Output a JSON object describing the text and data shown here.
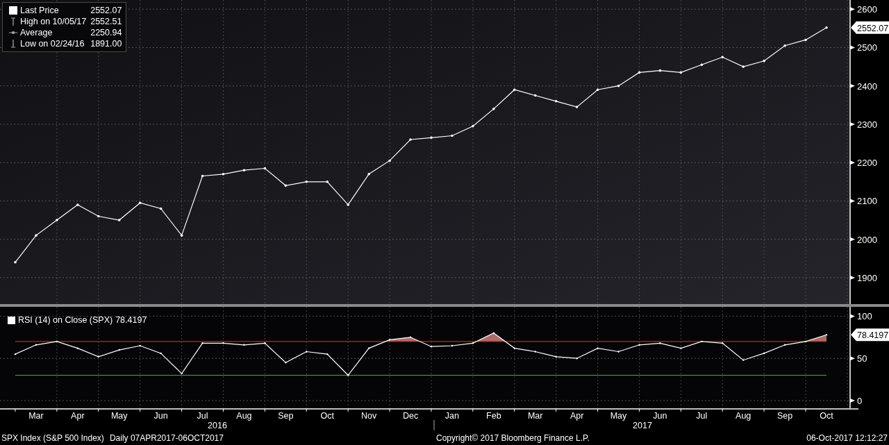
{
  "price_panel": {
    "legend": [
      {
        "kind": "last",
        "value": "2552.07"
      },
      {
        "kind": "high",
        "label": "High on 10/05/17",
        "value": "2552.51"
      },
      {
        "kind": "average",
        "label": "Average",
        "value": "2250.94"
      },
      {
        "kind": "low",
        "label": "Low on 02/24/16",
        "value": "1891.00"
      }
    ],
    "last_value_tag": "2552.07",
    "chart_data": {
      "type": "line",
      "grid": true,
      "series": [
        {
          "name": "Last Price",
          "color": "#ffffff",
          "values": [
            1940,
            2010,
            2050,
            2090,
            2060,
            2050,
            2095,
            2080,
            2010,
            2165,
            2170,
            2180,
            2185,
            2140,
            2150,
            2150,
            2090,
            2170,
            2205,
            2260,
            2265,
            2270,
            2295,
            2340,
            2390,
            2375,
            2360,
            2345,
            2390,
            2400,
            2435,
            2440,
            2435,
            2455,
            2475,
            2450,
            2465,
            2505,
            2520,
            2552
          ]
        }
      ],
      "ylim": [
        1831,
        2624
      ],
      "yticks": [
        1900,
        2000,
        2100,
        2200,
        2300,
        2400,
        2500,
        2600
      ]
    }
  },
  "rsi_panel": {
    "legend": {
      "value": "78.4197"
    },
    "last_value_tag": "78.4197",
    "chart_data": {
      "type": "line",
      "grid": true,
      "categories": [
        null,
        "Mar",
        null,
        "Apr",
        null,
        "May",
        null,
        "Jun",
        null,
        "Jul",
        null,
        "Aug",
        null,
        "Sep",
        null,
        "Oct",
        null,
        "Nov",
        null,
        "Dec",
        null,
        "Jan",
        null,
        "Feb",
        null,
        "Mar",
        null,
        "Apr",
        null,
        "May",
        null,
        "Jun",
        null,
        "Jul",
        null,
        "Aug",
        null,
        "Sep",
        null,
        "Oct"
      ],
      "series": [
        {
          "name": "RSI (14) on Close (SPX)",
          "color": "#ffffff",
          "values": [
            55,
            66,
            70,
            62,
            52,
            60,
            65,
            56,
            32,
            68,
            68,
            66,
            68,
            45,
            58,
            55,
            30,
            62,
            72,
            75,
            64,
            65,
            68,
            80,
            62,
            58,
            52,
            50,
            62,
            58,
            66,
            68,
            62,
            70,
            68,
            48,
            56,
            66,
            70,
            78
          ]
        },
        {
          "color": "#c0262b",
          "values": [
            70,
            70,
            70,
            70,
            70,
            70,
            70,
            70,
            70,
            70,
            70,
            70,
            70,
            70,
            70,
            70,
            70,
            70,
            70,
            70,
            70,
            70,
            70,
            70,
            70,
            70,
            70,
            70,
            70,
            70,
            70,
            70,
            70,
            70,
            70,
            70,
            70,
            70,
            70,
            70
          ]
        },
        {
          "color": "#3cb043",
          "values": [
            30,
            30,
            30,
            30,
            30,
            30,
            30,
            30,
            30,
            30,
            30,
            30,
            30,
            30,
            30,
            30,
            30,
            30,
            30,
            30,
            30,
            30,
            30,
            30,
            30,
            30,
            30,
            30,
            30,
            30,
            30,
            30,
            30,
            30,
            30,
            30,
            30,
            30,
            30,
            30
          ]
        }
      ],
      "ylim": [
        -9,
        111
      ],
      "yticks": [
        0,
        50,
        100
      ]
    }
  },
  "time_axis": {
    "years": [
      "2016",
      "2017"
    ]
  },
  "footer": {
    "security": "SPX Index (S&P 500 Index)",
    "range": "Daily 07APR2017-06OCT2017",
    "copyright": "Copyright© 2017 Bloomberg Finance L.P.",
    "timestamp": "06-Oct-2017 12:12:27"
  }
}
